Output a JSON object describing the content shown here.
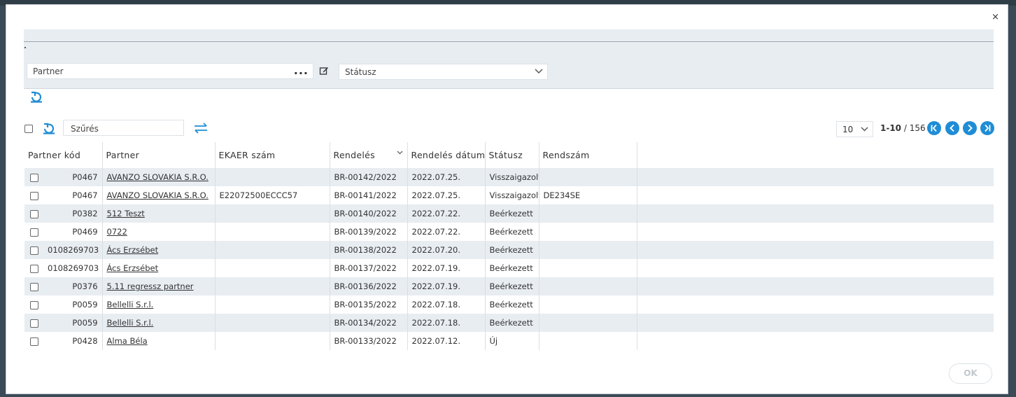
{
  "modal": {
    "close_label": "×",
    "ok_label": "OK"
  },
  "filters": {
    "partner_placeholder": "Partner",
    "partner_more": "...",
    "status_placeholder": "Státusz"
  },
  "toolbar": {
    "search_placeholder": "Szűrés"
  },
  "pager": {
    "page_size": "10",
    "range": "1-10",
    "total": "/ 156"
  },
  "columns": {
    "partner_code": "Partner kód",
    "partner": "Partner",
    "ekaer": "EKAER szám",
    "order": "Rendelés",
    "order_date": "Rendelés dátuma",
    "status": "Státusz",
    "plate": "Rendszám"
  },
  "rows": [
    {
      "code": "P0467",
      "partner": "AVANZO SLOVAKIA S.R.O.",
      "ekaer": "",
      "order": "BR-00142/2022",
      "date": "2022.07.25.",
      "status": "Visszaigazolt",
      "plate": ""
    },
    {
      "code": "P0467",
      "partner": "AVANZO SLOVAKIA S.R.O.",
      "ekaer": "E22072500ECCC57",
      "order": "BR-00141/2022",
      "date": "2022.07.25.",
      "status": "Visszaigazolt",
      "plate": "DE234SE"
    },
    {
      "code": "P0382",
      "partner": "512 Teszt",
      "ekaer": "",
      "order": "BR-00140/2022",
      "date": "2022.07.22.",
      "status": "Beérkezett",
      "plate": ""
    },
    {
      "code": "P0469",
      "partner": "0722",
      "ekaer": "",
      "order": "BR-00139/2022",
      "date": "2022.07.22.",
      "status": "Beérkezett",
      "plate": ""
    },
    {
      "code": "0108269703",
      "partner": "Ács Erzsébet",
      "ekaer": "",
      "order": "BR-00138/2022",
      "date": "2022.07.20.",
      "status": "Beérkezett",
      "plate": ""
    },
    {
      "code": "0108269703",
      "partner": "Ács Erzsébet",
      "ekaer": "",
      "order": "BR-00137/2022",
      "date": "2022.07.19.",
      "status": "Beérkezett",
      "plate": ""
    },
    {
      "code": "P0376",
      "partner": "5.11 regressz partner",
      "ekaer": "",
      "order": "BR-00136/2022",
      "date": "2022.07.19.",
      "status": "Beérkezett",
      "plate": ""
    },
    {
      "code": "P0059",
      "partner": "Bellelli S.r.l.",
      "ekaer": "",
      "order": "BR-00135/2022",
      "date": "2022.07.18.",
      "status": "Beérkezett",
      "plate": ""
    },
    {
      "code": "P0059",
      "partner": "Bellelli S.r.l.",
      "ekaer": "",
      "order": "BR-00134/2022",
      "date": "2022.07.18.",
      "status": "Beérkezett",
      "plate": ""
    },
    {
      "code": "P0428",
      "partner": "Alma Béla",
      "ekaer": "",
      "order": "BR-00133/2022",
      "date": "2022.07.12.",
      "status": "Új",
      "plate": ""
    }
  ],
  "colors": {
    "accent": "#1f8dd6",
    "row_alt": "#e8edf2"
  }
}
